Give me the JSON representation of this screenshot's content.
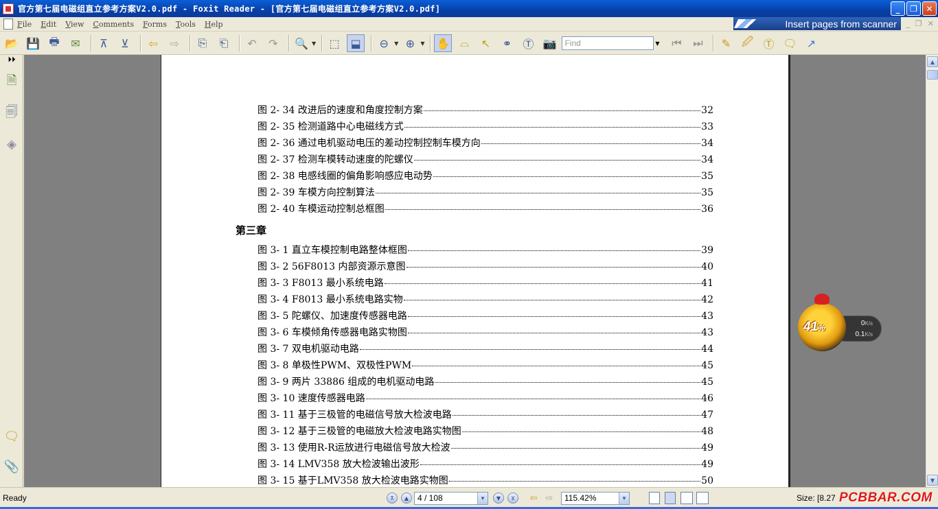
{
  "window": {
    "title": "官方第七届电磁组直立参考方案V2.0.pdf - Foxit Reader - [官方第七届电磁组直立参考方案V2.0.pdf]"
  },
  "menu": {
    "items": [
      {
        "key": "F",
        "rest": "ile"
      },
      {
        "key": "E",
        "rest": "dit"
      },
      {
        "key": "V",
        "rest": "iew"
      },
      {
        "key": "C",
        "rest": "omments"
      },
      {
        "key": "F",
        "rest": "orms"
      },
      {
        "key": "T",
        "rest": "ools"
      },
      {
        "key": "H",
        "rest": "elp"
      }
    ],
    "scanner_banner": "Insert pages from scanner"
  },
  "toolbar": {
    "find_placeholder": "Find"
  },
  "document": {
    "lines_before": [
      {
        "label": "图 2- 34  改进后的速度和角度控制方案",
        "page": "32"
      },
      {
        "label": "图 2- 35  检测道路中心电磁线方式",
        "page": "33"
      },
      {
        "label": "图 2- 36  通过电机驱动电压的差动控制控制车模方向",
        "page": "34"
      },
      {
        "label": "图 2- 37  检测车模转动速度的陀螺仪",
        "page": "34"
      },
      {
        "label": "图 2- 38  电感线圈的偏角影响感应电动势",
        "page": "35"
      },
      {
        "label": "图 2- 39  车模方向控制算法",
        "page": "35"
      },
      {
        "label": "图 2- 40  车模运动控制总框图",
        "page": "36"
      }
    ],
    "chapter": "第三章",
    "lines_after": [
      {
        "label": "图 3- 1  直立车模控制电路整体框图",
        "page": "39"
      },
      {
        "label": "图 3- 2 56F8013 内部资源示意图",
        "page": "40"
      },
      {
        "label": "图 3- 3 F8013 最小系统电路",
        "page": "41"
      },
      {
        "label": "图 3- 4 F8013 最小系统电路实物",
        "page": "42"
      },
      {
        "label": "图 3- 5  陀螺仪、加速度传感器电路",
        "page": "43"
      },
      {
        "label": "图 3- 6  车模倾角传感器电路实物图",
        "page": "43"
      },
      {
        "label": "图 3- 7  双电机驱动电路",
        "page": "44"
      },
      {
        "label": "图 3- 8 单极性PWM、双极性PWM",
        "page": "45"
      },
      {
        "label": "图 3- 9  两片 33886 组成的电机驱动电路",
        "page": "45"
      },
      {
        "label": "图 3- 10  速度传感器电路",
        "page": "46"
      },
      {
        "label": "图 3- 11  基于三极管的电磁信号放大检波电路",
        "page": "47"
      },
      {
        "label": "图 3- 12  基于三极管的电磁放大检波电路实物图",
        "page": "48"
      },
      {
        "label": "图 3- 13  使用R-R运放进行电磁信号放大检波",
        "page": "49"
      },
      {
        "label": "图 3- 14 LMV358 放大检波输出波形",
        "page": "49"
      },
      {
        "label": "图 3- 15  基于LMV358 放大检波电路实物图",
        "page": "50"
      }
    ]
  },
  "speed_widget": {
    "percent": "41",
    "percent_sign": "%",
    "upload": "0",
    "download": "0.1",
    "unit": "K/s"
  },
  "status": {
    "ready": "Ready",
    "page": "4 / 108",
    "zoom": "115.42%",
    "size": "Size: [8.27",
    "watermark": "PCBBAR.COM"
  }
}
